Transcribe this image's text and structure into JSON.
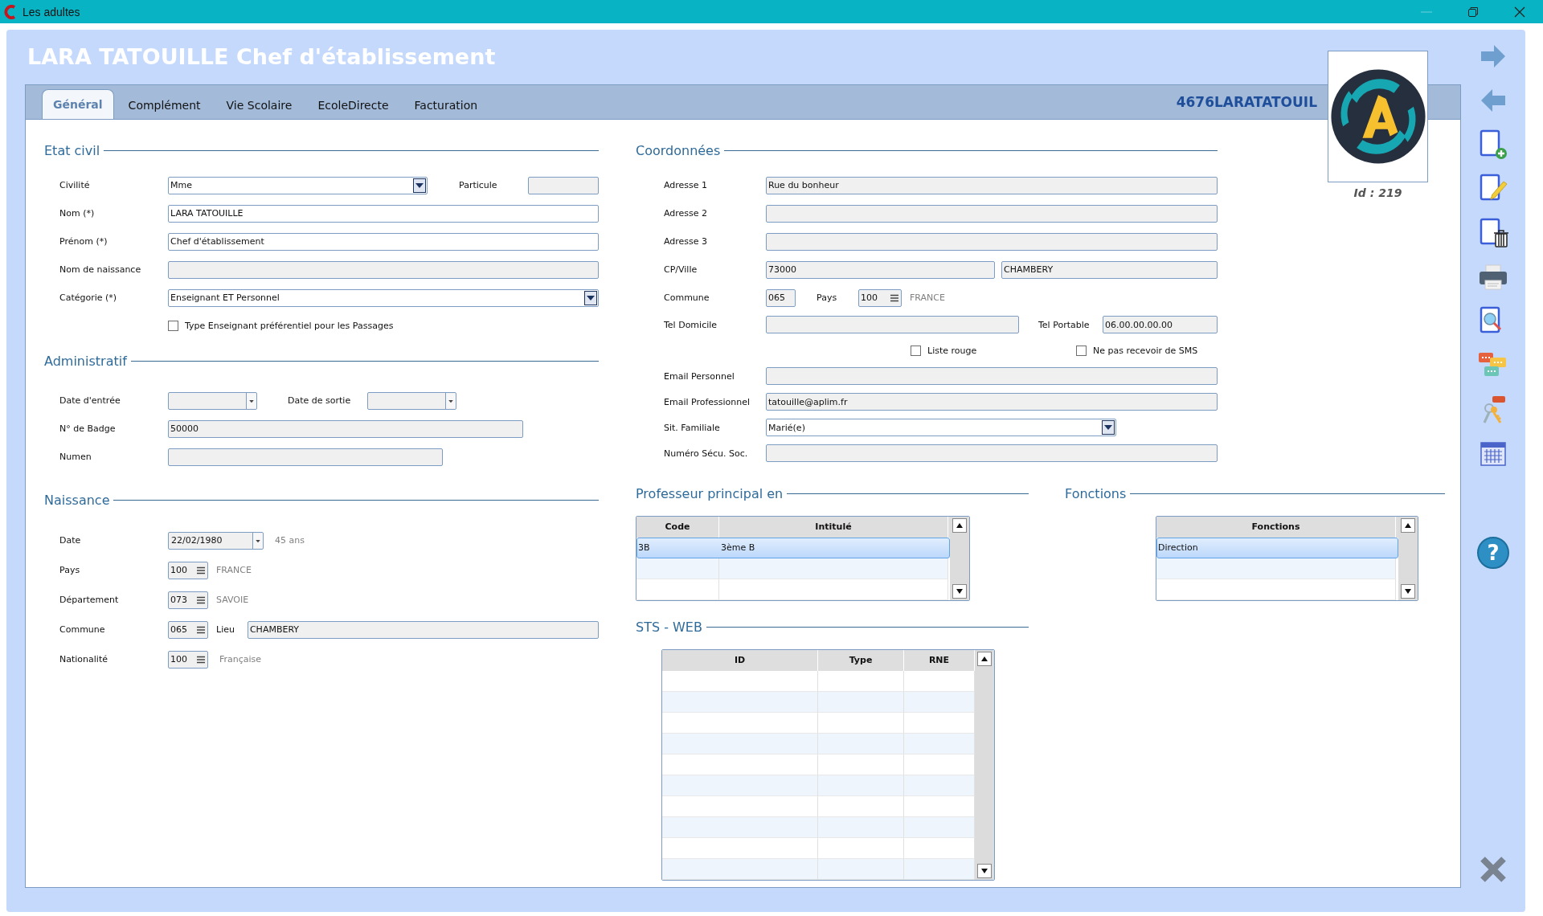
{
  "window": {
    "title": "Les adultes"
  },
  "header": {
    "title": "LARA TATOUILLE Chef d'établissement",
    "login": "4676LARATATOUIL",
    "id_label": "Id : 219"
  },
  "tabs": [
    {
      "label": "Général",
      "selected": true
    },
    {
      "label": "Complément",
      "selected": false
    },
    {
      "label": "Vie Scolaire",
      "selected": false
    },
    {
      "label": "EcoleDirecte",
      "selected": false
    },
    {
      "label": "Facturation",
      "selected": false
    }
  ],
  "etat_civil": {
    "title": "Etat civil",
    "rows": [
      [
        {
          "kind": "label",
          "text": "Civilité"
        },
        {
          "kind": "select",
          "value": "Mme",
          "disabled": false
        },
        {
          "kind": "label",
          "text": "Particule"
        },
        {
          "kind": "field",
          "disabled": true
        }
      ],
      [
        {
          "kind": "label",
          "text": "Nom (*)"
        },
        {
          "kind": "field",
          "value": "LARA TATOUILLE",
          "disabled": false
        }
      ],
      [
        {
          "kind": "label",
          "text": "Prénom (*)"
        },
        {
          "kind": "field",
          "value": "Chef d'établissement",
          "disabled": false
        }
      ],
      [
        {
          "kind": "label",
          "text": "Nom de naissance"
        },
        {
          "kind": "field",
          "disabled": true
        }
      ],
      [
        {
          "kind": "label",
          "text": "Catégorie (*)"
        },
        {
          "kind": "select",
          "value": "Enseignant ET Personnel",
          "disabled": false
        }
      ],
      [
        "",
        {
          "kind": "checkbox",
          "label": "Type Enseignant préférentiel pour les Passages",
          "checked": false
        }
      ]
    ]
  },
  "administratif": {
    "title": "Administratif",
    "rows": [
      [
        {
          "kind": "label",
          "text": "Date d'entrée"
        },
        {
          "kind": "date",
          "disabled": true
        },
        {
          "kind": "label",
          "text": "Date de sortie"
        },
        {
          "kind": "date",
          "disabled": true
        }
      ],
      [
        {
          "kind": "label",
          "text": "N° de Badge"
        },
        {
          "kind": "field",
          "value": "50000",
          "disabled": true
        }
      ],
      [
        {
          "kind": "label",
          "text": "Numen"
        },
        {
          "kind": "field",
          "disabled": true
        }
      ]
    ]
  },
  "naissance": {
    "title": "Naissance",
    "rows": [
      [
        {
          "kind": "label",
          "text": "Date"
        },
        {
          "kind": "date",
          "value": "22/02/1980",
          "disabled": true
        },
        "",
        {
          "kind": "note",
          "text": "45 ans"
        }
      ],
      [
        {
          "kind": "label",
          "text": "Pays"
        },
        {
          "kind": "lookup",
          "value": "100",
          "disabled": true
        },
        {
          "kind": "note",
          "text": "FRANCE"
        }
      ],
      [
        {
          "kind": "label",
          "text": "Département"
        },
        {
          "kind": "lookup",
          "value": "073",
          "disabled": true
        },
        {
          "kind": "note",
          "text": "SAVOIE"
        }
      ],
      [
        {
          "kind": "label",
          "text": "Commune"
        },
        {
          "kind": "lookup",
          "value": "065",
          "disabled": true
        },
        {
          "kind": "label",
          "text": "Lieu"
        },
        {
          "kind": "field",
          "value": "CHAMBERY",
          "disabled": true
        }
      ],
      [
        {
          "kind": "label",
          "text": "Nationalité"
        },
        {
          "kind": "lookup",
          "value": "100",
          "disabled": true
        },
        {
          "kind": "note",
          "text": "Française"
        }
      ]
    ]
  },
  "coordonnees": {
    "title": "Coordonnées",
    "rows": [
      [
        {
          "kind": "label",
          "text": "Adresse 1"
        },
        {
          "kind": "field",
          "value": "Rue du bonheur",
          "disabled": true
        }
      ],
      [
        {
          "kind": "label",
          "text": "Adresse 2"
        },
        {
          "kind": "field",
          "disabled": true
        }
      ],
      [
        {
          "kind": "label",
          "text": "Adresse 3"
        },
        {
          "kind": "field",
          "disabled": true
        }
      ],
      [
        {
          "kind": "label",
          "text": "CP/Ville"
        },
        {
          "kind": "field",
          "value": "73000",
          "disabled": true
        },
        {
          "kind": "field",
          "value": "CHAMBERY",
          "disabled": true
        }
      ],
      [
        {
          "kind": "label",
          "text": "Commune"
        },
        {
          "kind": "field",
          "value": "065",
          "disabled": true
        },
        {
          "kind": "label",
          "text": "Pays"
        },
        {
          "kind": "lookup",
          "value": "100",
          "disabled": true
        },
        {
          "kind": "note",
          "text": "FRANCE"
        }
      ],
      [
        {
          "kind": "label",
          "text": "Tel Domicile"
        },
        {
          "kind": "field",
          "disabled": true
        },
        {
          "kind": "label",
          "text": "Tel Portable"
        },
        {
          "kind": "field",
          "value": "06.00.00.00.00",
          "disabled": true
        }
      ],
      [
        {
          "kind": "checkbox",
          "label": "Liste rouge",
          "checked": false
        },
        {
          "kind": "checkbox",
          "label": "Ne pas recevoir de SMS",
          "checked": false
        }
      ],
      [
        {
          "kind": "label",
          "text": "Email Personnel"
        },
        {
          "kind": "field",
          "disabled": true
        }
      ],
      [
        {
          "kind": "label",
          "text": "Email Professionnel"
        },
        {
          "kind": "field",
          "value": "tatouille@aplim.fr",
          "disabled": true
        }
      ],
      [
        {
          "kind": "label",
          "text": "Sit. Familiale"
        },
        {
          "kind": "select",
          "value": "Marié(e)",
          "disabled": false
        }
      ],
      [
        {
          "kind": "label",
          "text": "Numéro Sécu. Soc."
        },
        {
          "kind": "field",
          "disabled": true
        }
      ]
    ]
  },
  "professeur_principal": {
    "title": "Professeur principal en",
    "table": {
      "columns": [
        "Code",
        "Intitulé"
      ],
      "rows": [
        {
          "cells": [
            "3B",
            "3ème B"
          ],
          "selected": true
        }
      ]
    }
  },
  "sts_web": {
    "title": "STS - WEB",
    "table": {
      "columns": [
        "ID",
        "Type",
        "RNE"
      ]
    }
  },
  "fonctions": {
    "title": "Fonctions",
    "table": {
      "columns": [
        "Fonctions"
      ],
      "rows": [
        {
          "cells": [
            "Direction"
          ],
          "selected": true
        }
      ]
    }
  },
  "help_button": {
    "label": "?"
  }
}
